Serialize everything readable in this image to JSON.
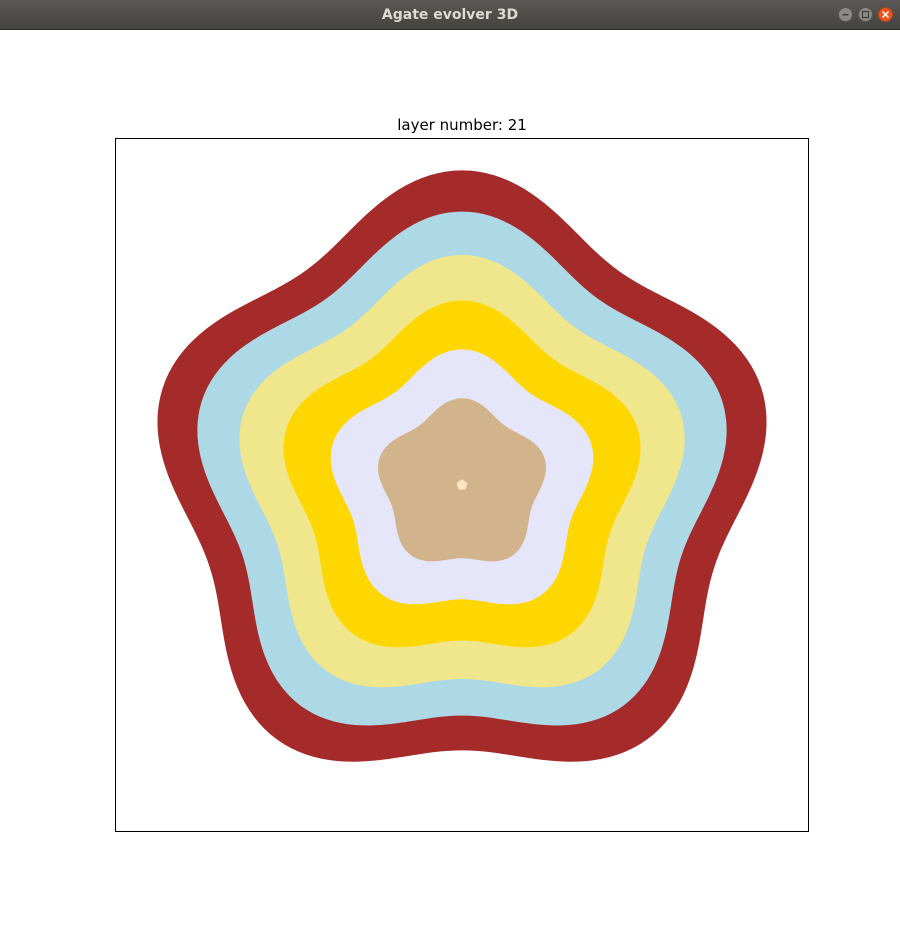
{
  "window": {
    "title": "Agate evolver 3D",
    "buttons": {
      "minimize": "minimize-icon",
      "maximize": "maximize-icon",
      "close": "close-icon"
    }
  },
  "plot": {
    "title": "layer number: 21"
  },
  "layers": [
    {
      "color": "#a52a2a",
      "radius": 290
    },
    {
      "color": "#add8e6",
      "radius": 252
    },
    {
      "color": "#f0e68c",
      "radius": 212
    },
    {
      "color": "#ffd700",
      "radius": 170
    },
    {
      "color": "#e6e6fa",
      "radius": 125
    },
    {
      "color": "#d2b48c",
      "radius": 80
    },
    {
      "color": "#ffe4c4",
      "radius": 5
    }
  ]
}
